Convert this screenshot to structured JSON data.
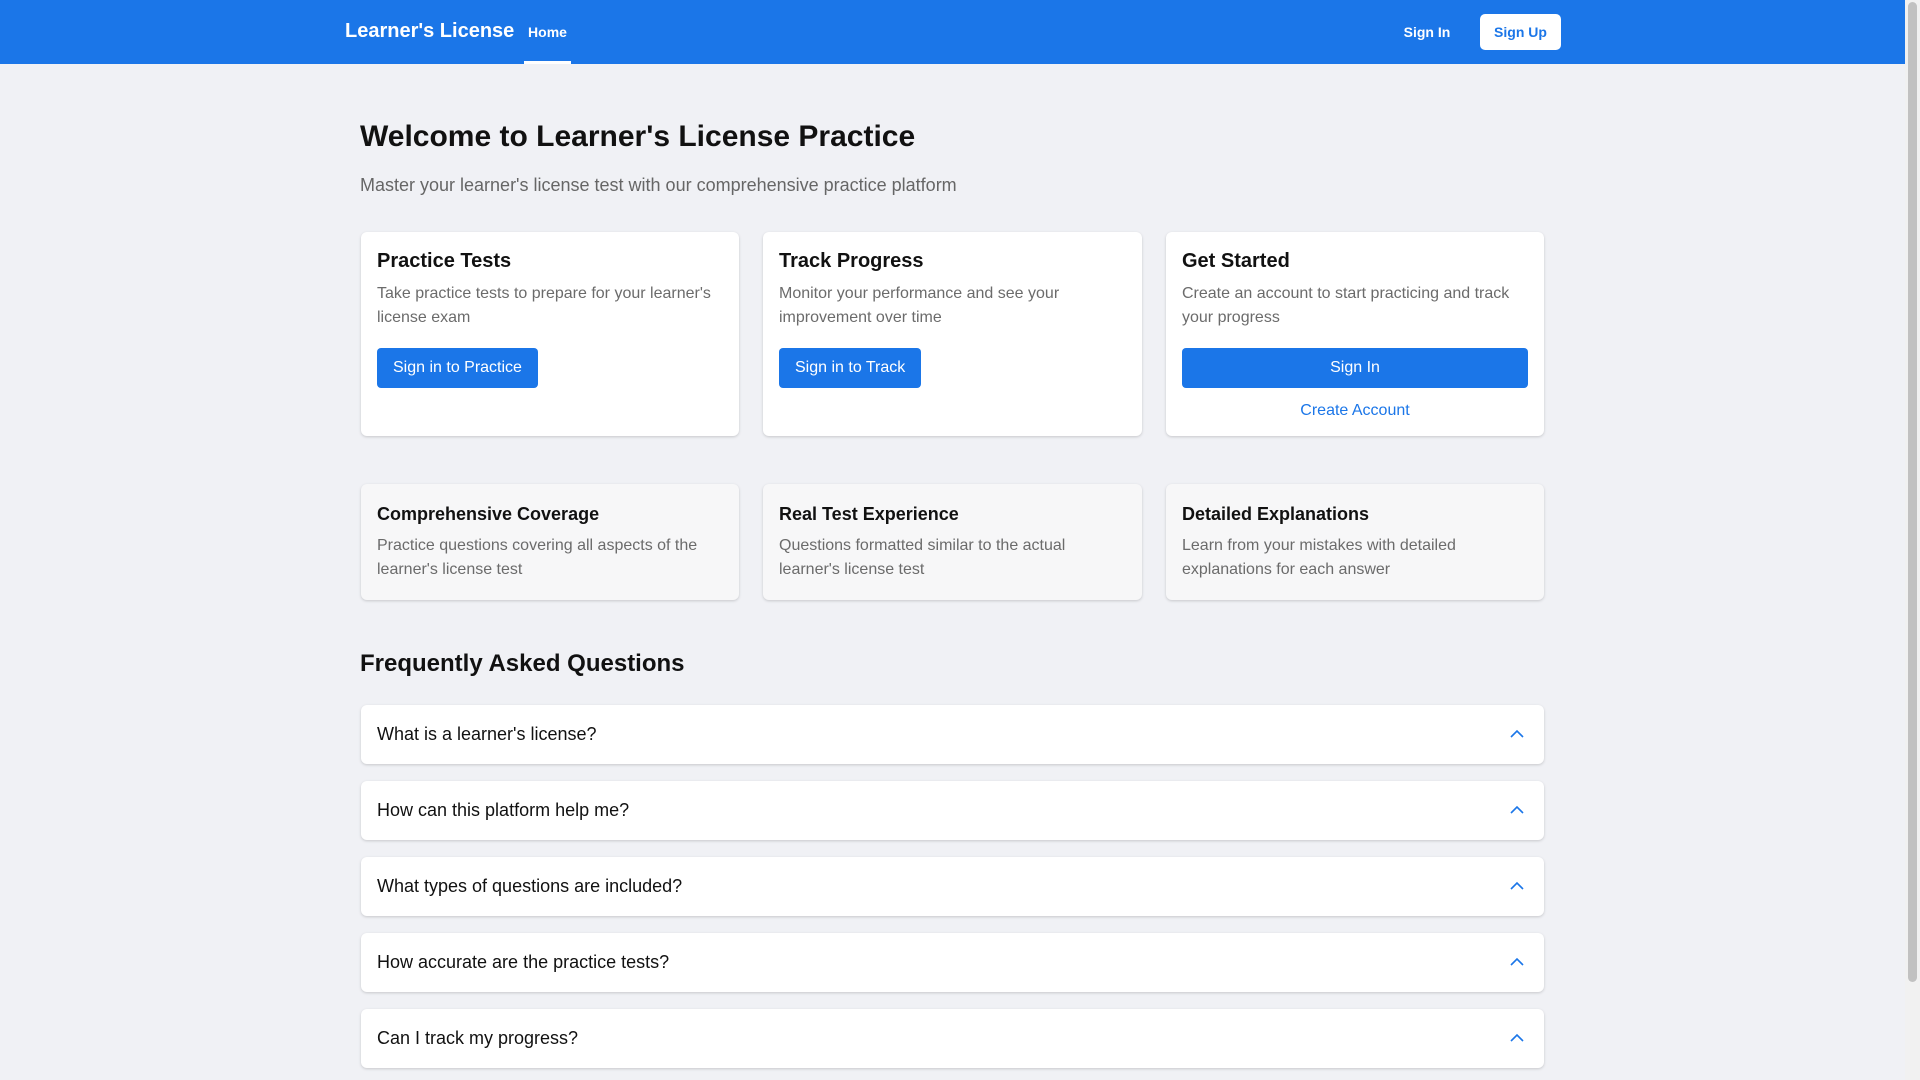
{
  "appbar": {
    "brand": "Learner's License",
    "nav_home": "Home",
    "sign_in": "Sign In",
    "sign_up": "Sign Up"
  },
  "hero": {
    "title": "Welcome to Learner's License Practice",
    "subtitle": "Master your learner's license test with our comprehensive practice platform"
  },
  "cards": [
    {
      "title": "Practice Tests",
      "description": "Take practice tests to prepare for your learner's license exam",
      "button": "Sign in to Practice"
    },
    {
      "title": "Track Progress",
      "description": "Monitor your performance and see your improvement over time",
      "button": "Sign in to Track"
    },
    {
      "title": "Get Started",
      "description": "Create an account to start practicing and track your progress",
      "button": "Sign In",
      "link": "Create Account"
    }
  ],
  "features": [
    {
      "title": "Comprehensive Coverage",
      "description": "Practice questions covering all aspects of the learner's license test"
    },
    {
      "title": "Real Test Experience",
      "description": "Questions formatted similar to the actual learner's license test"
    },
    {
      "title": "Detailed Explanations",
      "description": "Learn from your mistakes with detailed explanations for each answer"
    }
  ],
  "faq": {
    "title": "Frequently Asked Questions",
    "items": [
      "What is a learner's license?",
      "How can this platform help me?",
      "What types of questions are included?",
      "How accurate are the practice tests?",
      "Can I track my progress?"
    ]
  },
  "icons": {
    "faq_chevron": "chevron-up-icon"
  },
  "colors": {
    "primary": "#1b76e8",
    "background": "#f0f1f5"
  }
}
